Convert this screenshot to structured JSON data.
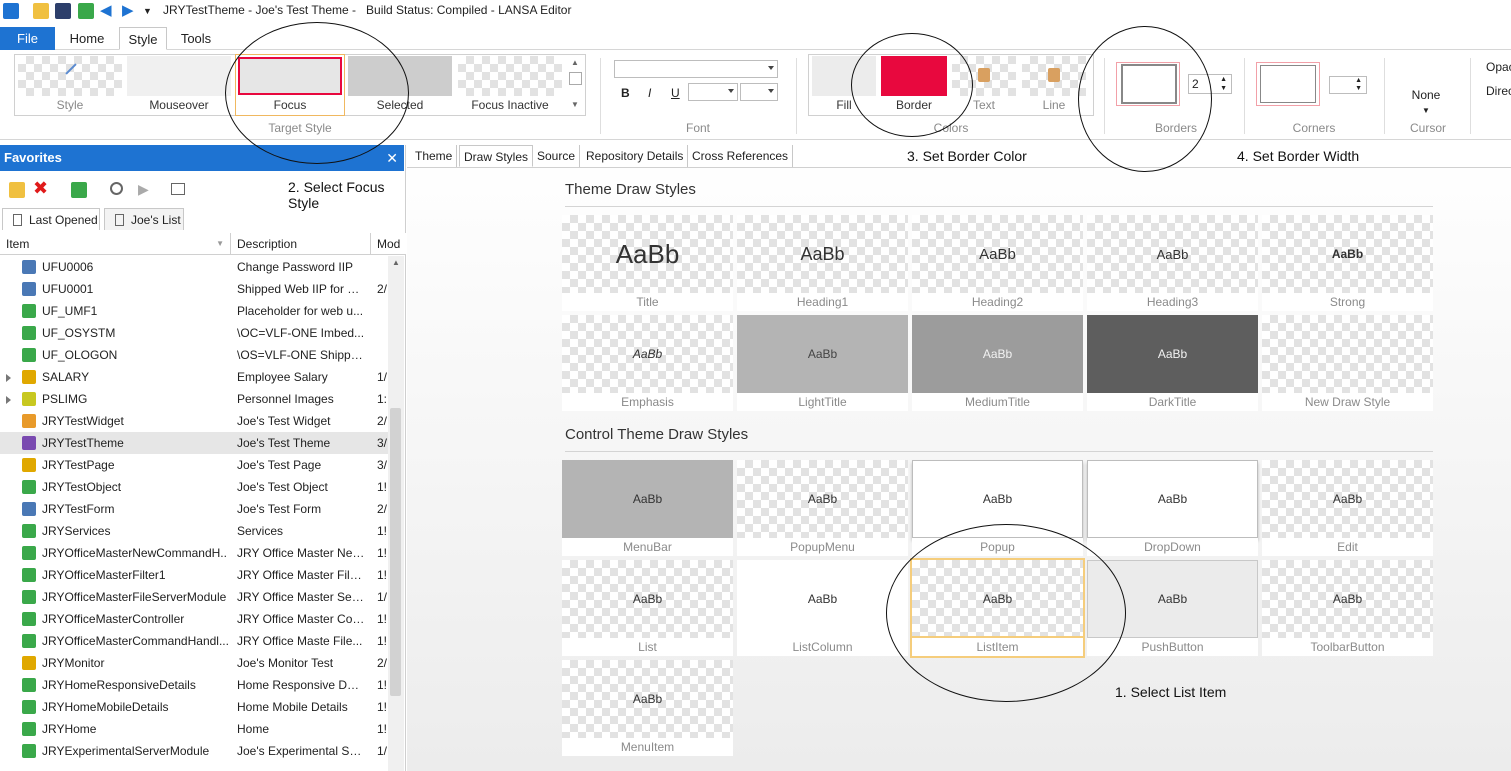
{
  "window": {
    "title": "JRYTestTheme - Joe's Test Theme -   Build Status: Compiled - LANSA Editor"
  },
  "menu_tabs": [
    "File",
    "Home",
    "Style",
    "Tools"
  ],
  "ribbon": {
    "target_style": {
      "group_label": "Target Style",
      "items": [
        "Style",
        "Mouseover",
        "Focus",
        "Selected",
        "Focus Inactive"
      ]
    },
    "font": {
      "group_label": "Font",
      "bold": "B",
      "italic": "I",
      "underline": "U"
    },
    "colors": {
      "group_label": "Colors",
      "items": [
        "Fill",
        "Border",
        "Text",
        "Line"
      ],
      "border_color": "#e8083e"
    },
    "borders": {
      "group_label": "Borders",
      "width_value": "2"
    },
    "corners": {
      "group_label": "Corners"
    },
    "cursor": {
      "group_label": "Cursor",
      "value": "None"
    },
    "extra": [
      "Opac",
      "Direc"
    ]
  },
  "favorites": {
    "title": "Favorites",
    "close": "✕",
    "tabs": [
      "Last Opened",
      "Joe's List"
    ],
    "columns": [
      "Item",
      "Description",
      "Mod"
    ],
    "rows": [
      {
        "name": "UFU0006",
        "desc": "Change Password IIP",
        "mod": "",
        "icon": "form-icon",
        "color": "#4a78b5"
      },
      {
        "name": "UFU0001",
        "desc": "Shipped Web IIP for U...",
        "mod": "2/",
        "icon": "form-icon",
        "color": "#4a78b5"
      },
      {
        "name": "UF_UMF1",
        "desc": "Placeholder for web u...",
        "mod": "",
        "icon": "reusable-part-icon",
        "color": "#3aa84a"
      },
      {
        "name": "UF_OSYSTM",
        "desc": "\\OC=VLF-ONE Imbed...",
        "mod": "",
        "icon": "reusable-part-icon",
        "color": "#3aa84a"
      },
      {
        "name": "UF_OLOGON",
        "desc": "\\OS=VLF-ONE Shippe...",
        "mod": "",
        "icon": "reusable-part-icon",
        "color": "#3aa84a"
      },
      {
        "name": "SALARY",
        "desc": "Employee Salary",
        "mod": "1/",
        "icon": "file-icon",
        "color": "#e0a800",
        "expandable": true
      },
      {
        "name": "PSLIMG",
        "desc": "Personnel Images",
        "mod": "1:",
        "icon": "file-icon",
        "color": "#c8c820",
        "expandable": true
      },
      {
        "name": "JRYTestWidget",
        "desc": "Joe's Test Widget",
        "mod": "2/",
        "icon": "widget-icon",
        "color": "#e89a2a"
      },
      {
        "name": "JRYTestTheme",
        "desc": "Joe's Test Theme",
        "mod": "3/",
        "icon": "theme-icon",
        "color": "#7a4ab0",
        "selected": true
      },
      {
        "name": "JRYTestPage",
        "desc": "Joe's Test Page",
        "mod": "3/",
        "icon": "web-page-icon",
        "color": "#e0a800"
      },
      {
        "name": "JRYTestObject",
        "desc": "Joe's Test Object",
        "mod": "1!",
        "icon": "reusable-part-icon",
        "color": "#3aa84a"
      },
      {
        "name": "JRYTestForm",
        "desc": "Joe's Test Form",
        "mod": "2/",
        "icon": "form-icon",
        "color": "#4a78b5"
      },
      {
        "name": "JRYServices",
        "desc": "Services",
        "mod": "1!",
        "icon": "server-module-icon",
        "color": "#3aa84a"
      },
      {
        "name": "JRYOfficeMasterNewCommandH...",
        "desc": "JRY Office Master New...",
        "mod": "1!",
        "icon": "reusable-part-icon",
        "color": "#3aa84a"
      },
      {
        "name": "JRYOfficeMasterFilter1",
        "desc": "JRY Office Master File...",
        "mod": "1!",
        "icon": "reusable-part-icon",
        "color": "#3aa84a"
      },
      {
        "name": "JRYOfficeMasterFileServerModule",
        "desc": "JRY Office Master Serv...",
        "mod": "1/",
        "icon": "server-module-icon",
        "color": "#3aa84a"
      },
      {
        "name": "JRYOfficeMasterController",
        "desc": "JRY Office Master Con...",
        "mod": "1!",
        "icon": "reusable-part-icon",
        "color": "#3aa84a"
      },
      {
        "name": "JRYOfficeMasterCommandHandl...",
        "desc": "JRY Office Maste File...",
        "mod": "1!",
        "icon": "reusable-part-icon",
        "color": "#3aa84a"
      },
      {
        "name": "JRYMonitor",
        "desc": "Joe's Monitor Test",
        "mod": "2/",
        "icon": "web-page-icon",
        "color": "#e0a800"
      },
      {
        "name": "JRYHomeResponsiveDetails",
        "desc": "Home Responsive Det...",
        "mod": "1!",
        "icon": "reusable-part-icon",
        "color": "#3aa84a"
      },
      {
        "name": "JRYHomeMobileDetails",
        "desc": "Home Mobile Details",
        "mod": "1!",
        "icon": "reusable-part-icon",
        "color": "#3aa84a"
      },
      {
        "name": "JRYHome",
        "desc": "Home",
        "mod": "1!",
        "icon": "reusable-part-icon",
        "color": "#3aa84a"
      },
      {
        "name": "JRYExperimentalServerModule",
        "desc": "Joe's Experimental Ser...",
        "mod": "1/",
        "icon": "server-module-icon",
        "color": "#3aa84a"
      }
    ]
  },
  "editor_tabs": [
    "Theme",
    "Draw Styles",
    "Source",
    "Repository Details",
    "Cross References"
  ],
  "theme_draw_styles": {
    "title": "Theme Draw Styles",
    "sample": "AaBb",
    "tiles": [
      {
        "label": "Title",
        "size": 26,
        "style": "normal",
        "weight": "normal",
        "bg": "check"
      },
      {
        "label": "Heading1",
        "size": 18,
        "style": "normal",
        "weight": "normal",
        "bg": "check"
      },
      {
        "label": "Heading2",
        "size": 15,
        "style": "normal",
        "weight": "normal",
        "bg": "check"
      },
      {
        "label": "Heading3",
        "size": 13,
        "style": "normal",
        "weight": "normal",
        "bg": "check"
      },
      {
        "label": "Strong",
        "size": 12,
        "style": "normal",
        "weight": "bold",
        "bg": "check"
      },
      {
        "label": "Emphasis",
        "size": 12,
        "style": "italic",
        "weight": "normal",
        "bg": "check"
      },
      {
        "label": "LightTitle",
        "size": 12,
        "style": "normal",
        "weight": "normal",
        "bg": "#b4b4b4",
        "fg": "#444"
      },
      {
        "label": "MediumTitle",
        "size": 12,
        "style": "normal",
        "weight": "normal",
        "bg": "#9c9c9c",
        "fg": "#f2f2f2"
      },
      {
        "label": "DarkTitle",
        "size": 12,
        "style": "normal",
        "weight": "normal",
        "bg": "#5e5e5e",
        "fg": "#f2f2f2"
      },
      {
        "label": "New Draw Style",
        "size": 12,
        "style": "normal",
        "weight": "normal",
        "bg": "check",
        "hide_sample": true
      }
    ]
  },
  "control_draw_styles": {
    "title": "Control Theme Draw Styles",
    "sample": "AaBb",
    "tiles": [
      {
        "label": "MenuBar",
        "bg": "#b4b4b4"
      },
      {
        "label": "PopupMenu",
        "bg": "check"
      },
      {
        "label": "Popup",
        "bg": "#ffffff",
        "border": "#bdbdbd",
        "shadow": true
      },
      {
        "label": "DropDown",
        "bg": "#ffffff",
        "border": "#bdbdbd",
        "shadow": true
      },
      {
        "label": "Edit",
        "bg": "check"
      },
      {
        "label": "List",
        "bg": "check"
      },
      {
        "label": "ListColumn",
        "bg": "#ffffff"
      },
      {
        "label": "ListItem",
        "bg": "check",
        "highlight": "#f5cd7c"
      },
      {
        "label": "PushButton",
        "bg": "#ebebeb",
        "border": "#c8c8c8"
      },
      {
        "label": "ToolbarButton",
        "bg": "check"
      },
      {
        "label": "MenuItem",
        "bg": "check"
      }
    ]
  },
  "annotations": {
    "step1": "1. Select List Item",
    "step2": "2. Select Focus Style",
    "step3": "3. Set Border Color",
    "step4": "4. Set Border Width"
  }
}
